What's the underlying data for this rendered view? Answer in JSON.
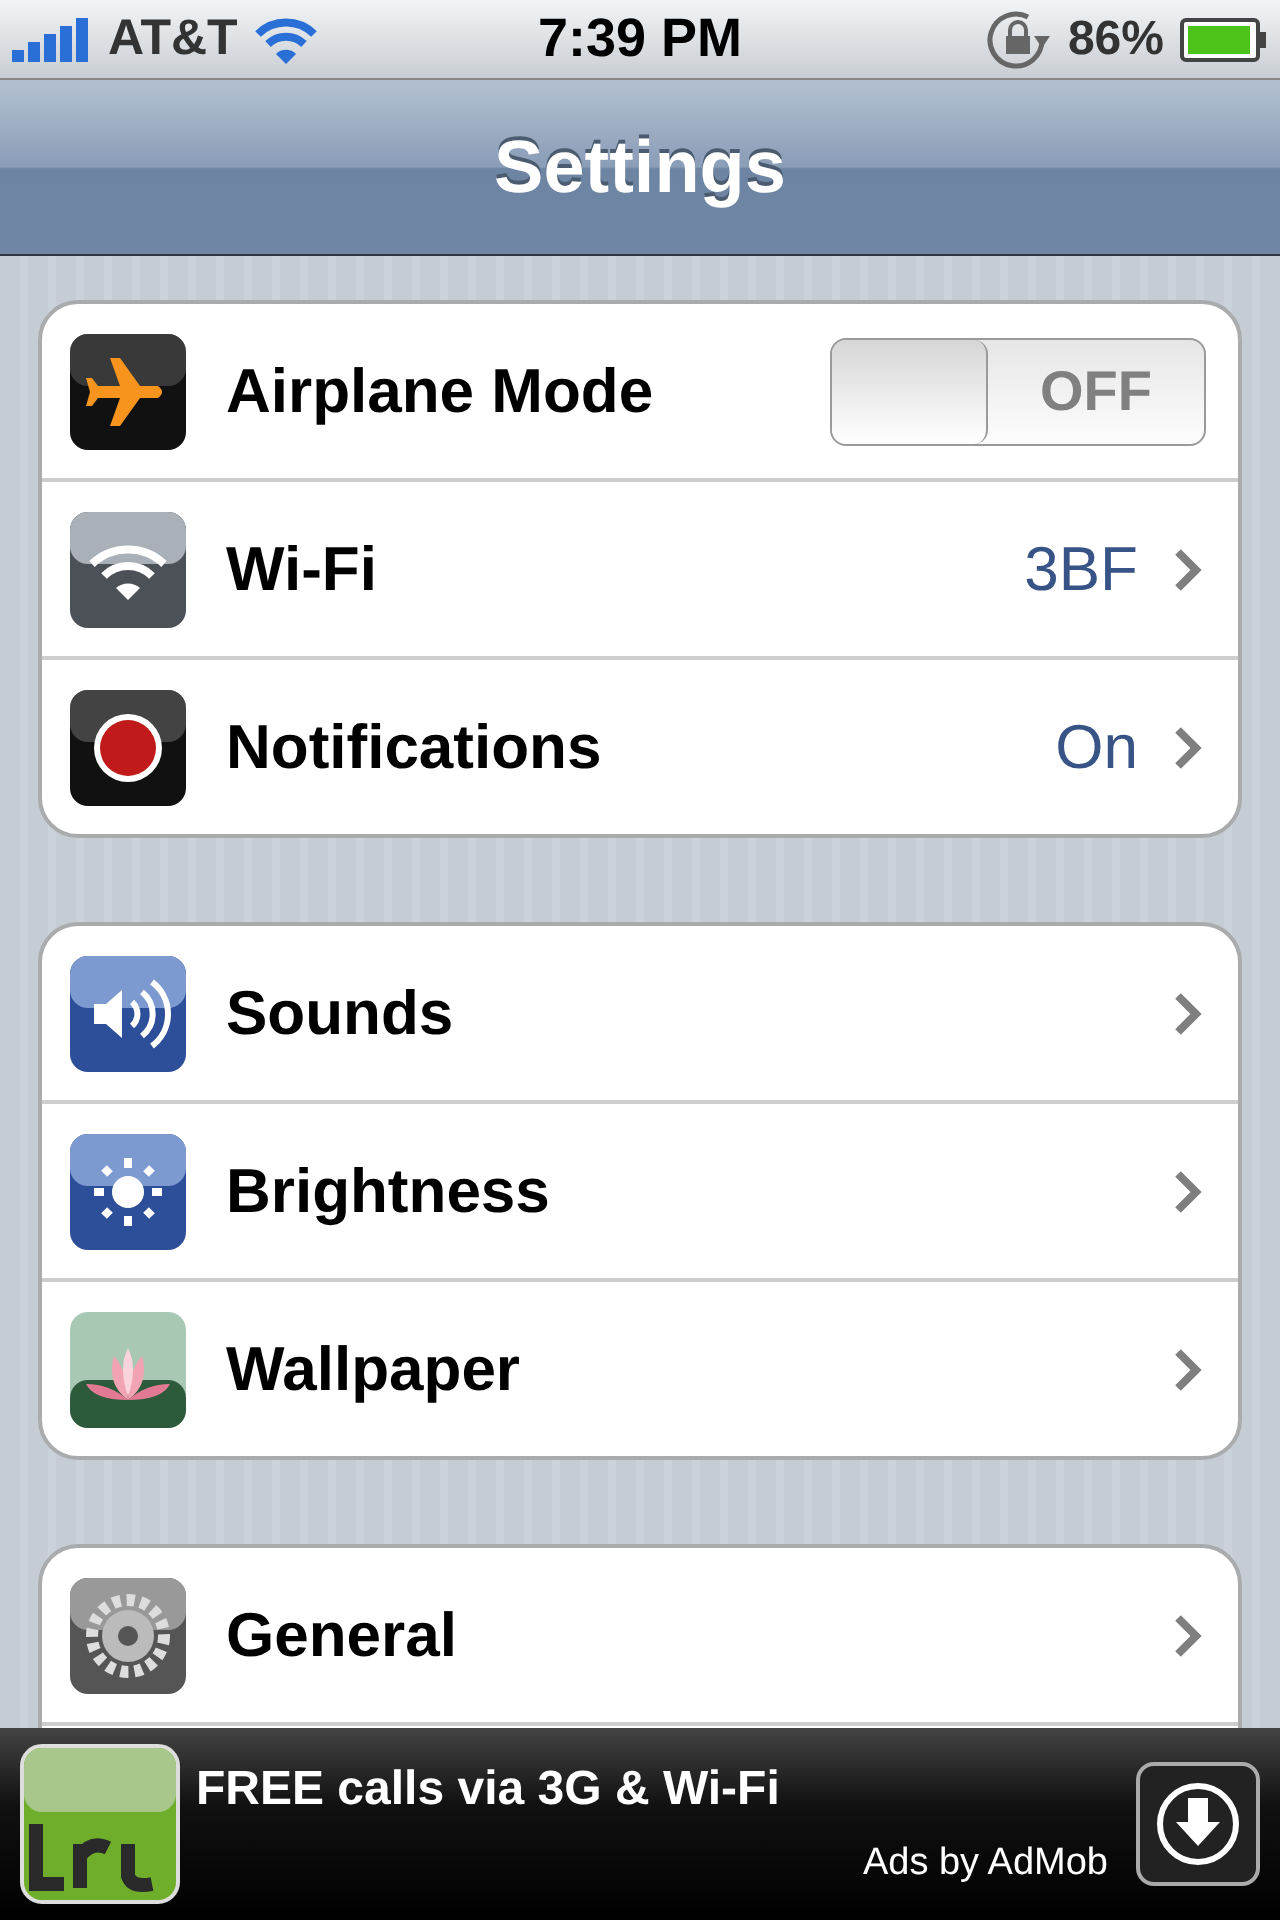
{
  "status_bar": {
    "carrier": "AT&T",
    "time": "7:39 PM",
    "battery": "86%"
  },
  "nav_bar": {
    "title": "Settings"
  },
  "groups": [
    {
      "rows": [
        {
          "kind": "toggle",
          "label": "Airplane Mode",
          "toggle": {
            "on": false,
            "label": "OFF"
          }
        },
        {
          "kind": "link",
          "label": "Wi-Fi",
          "value": "3BF"
        },
        {
          "kind": "link",
          "label": "Notifications",
          "value": "On"
        }
      ]
    },
    {
      "rows": [
        {
          "kind": "link",
          "label": "Sounds"
        },
        {
          "kind": "link",
          "label": "Brightness"
        },
        {
          "kind": "link",
          "label": "Wallpaper"
        }
      ]
    },
    {
      "rows": [
        {
          "kind": "link",
          "label": "General"
        }
      ]
    }
  ],
  "ad_banner": {
    "headline": "FREE calls via 3G & Wi-Fi",
    "attribution": "Ads by AdMob"
  }
}
